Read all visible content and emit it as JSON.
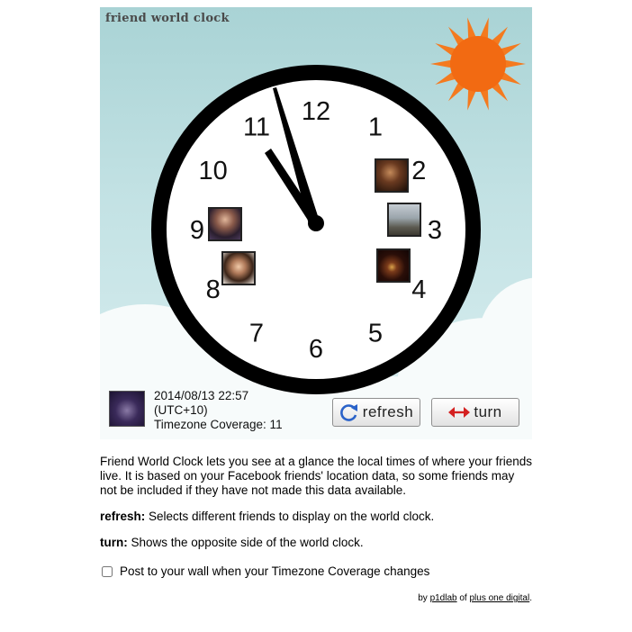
{
  "app": {
    "title": "friend world clock"
  },
  "clock": {
    "numerals": [
      "12",
      "1",
      "2",
      "3",
      "4",
      "5",
      "6",
      "7",
      "8",
      "9",
      "10",
      "11"
    ]
  },
  "friends": [
    {
      "name": "friend-photo-2",
      "style": "man-dark"
    },
    {
      "name": "friend-photo-3",
      "style": "landscape"
    },
    {
      "name": "friend-photo-4",
      "style": "night-moon"
    },
    {
      "name": "friend-photo-9",
      "style": "woman-dark"
    },
    {
      "name": "friend-photo-8",
      "style": "woman-light"
    }
  ],
  "status": {
    "datetime": "2014/08/13 22:57",
    "utc": "(UTC+10)",
    "coverage": "Timezone Coverage: 11"
  },
  "buttons": {
    "refresh": "refresh",
    "turn": "turn"
  },
  "description": {
    "intro": "Friend World Clock lets you see at a glance the local times of where your friends live. It is based on your Facebook friends' location data, so some friends may not be included if they have not made this data available.",
    "refresh_term": "refresh:",
    "refresh_text": " Selects different friends to display on the world clock.",
    "turn_term": "turn:",
    "turn_text": " Shows the opposite side of the world clock."
  },
  "post_option": {
    "label": "Post to your wall when your Timezone Coverage changes"
  },
  "credit": {
    "by": "by ",
    "author": "p1dlab",
    "of": " of ",
    "company": "plus one digital",
    "end": "."
  },
  "colors": {
    "sun": "#f47a1f",
    "sun_core": "#f26a12",
    "sky": "#a9d3d5",
    "clock_rim": "#000000"
  }
}
